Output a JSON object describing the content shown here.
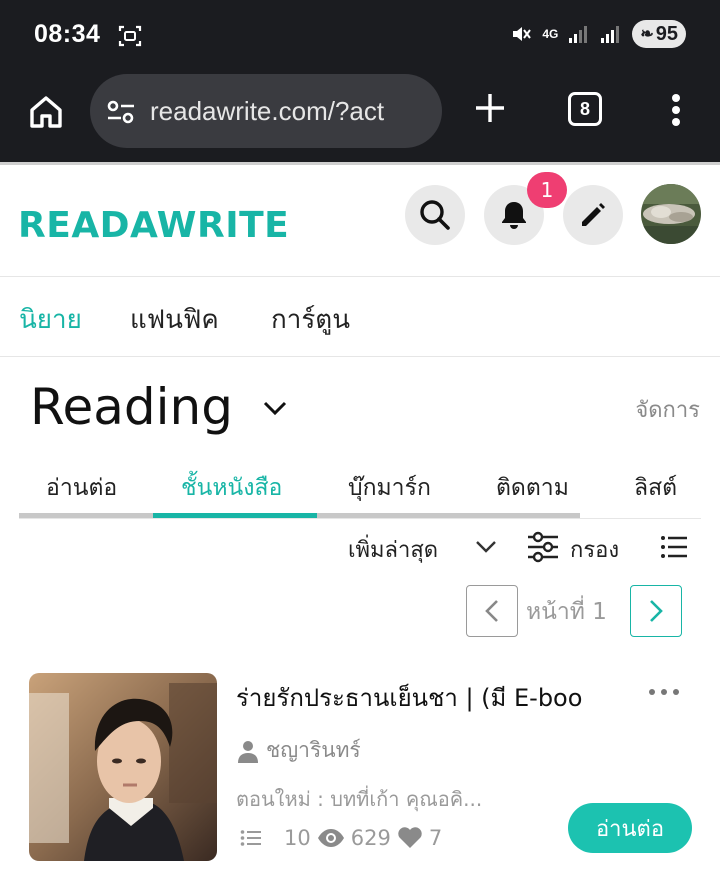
{
  "status_bar": {
    "time": "08:34",
    "network": "4G",
    "battery": "95"
  },
  "browser": {
    "url": "readawrite.com/?act",
    "tab_count": "8"
  },
  "site": {
    "logo": "READAWRITE",
    "notification_count": "1"
  },
  "categories": [
    {
      "label": "นิยาย",
      "active": true
    },
    {
      "label": "แฟนฟิค",
      "active": false
    },
    {
      "label": "การ์ตูน",
      "active": false
    }
  ],
  "reading": {
    "title": "Reading",
    "manage": "จัดการ"
  },
  "shelf_tabs": [
    {
      "label": "อ่านต่อ",
      "active": false
    },
    {
      "label": "ชั้นหนังสือ",
      "active": true
    },
    {
      "label": "บุ๊กมาร์ก",
      "active": false
    },
    {
      "label": "ติดตาม",
      "active": false
    },
    {
      "label": "ลิสต์",
      "active": false
    }
  ],
  "sort": {
    "label": "เพิ่มล่าสุด",
    "filter": "กรอง"
  },
  "pager": {
    "label": "หน้าที่ 1"
  },
  "book": {
    "title": "ร่ายรักประธานเย็นชา | (มี E-boo",
    "author": "ชญารินทร์",
    "latest": "ตอนใหม่ : บทที่เก้า คุณอคิ...",
    "chapters": "10",
    "views": "629",
    "likes": "7",
    "read_button": "อ่านต่อ"
  },
  "colors": {
    "accent": "#18b5a6",
    "badge": "#ef3e72",
    "dark_bar": "#1b1c20"
  }
}
